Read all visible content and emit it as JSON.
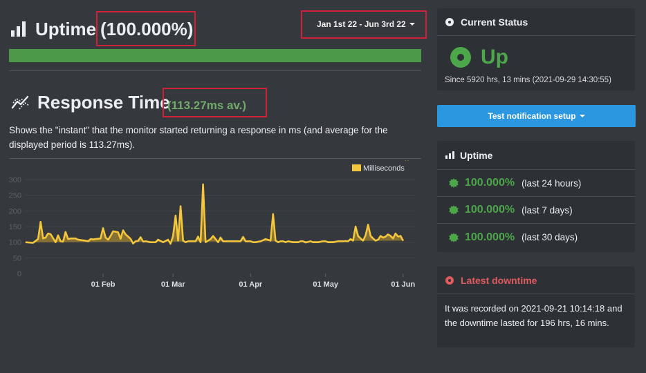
{
  "uptime": {
    "title": "Uptime",
    "percent_label": "(100.000%)",
    "bar_fill_percent": 100,
    "bar_color": "#4a9a48",
    "date_range_label": "Jan 1st 22 - Jun 3rd 22"
  },
  "response_time": {
    "title": "Response Time",
    "average_label": "(113.27ms av.)",
    "description": "Shows the \"instant\" that the monitor started returning a response in ms (and average for the displayed period is 113.27ms)."
  },
  "chart_data": {
    "type": "area",
    "title": "",
    "xlabel": "",
    "ylabel": "",
    "legend": "top-right",
    "grid": true,
    "ylim": [
      0,
      300
    ],
    "yticks": [
      0,
      50,
      100,
      150,
      200,
      250,
      300
    ],
    "x_start": "2022-01-01",
    "x_end": "2022-06-03",
    "xticks": [
      {
        "label": "01 Feb",
        "day": 31
      },
      {
        "label": "01 Mar",
        "day": 59
      },
      {
        "label": "01 Apr",
        "day": 90
      },
      {
        "label": "01 May",
        "day": 120
      },
      {
        "label": "01 Jun",
        "day": 151
      }
    ],
    "line_color": "#f4c63d",
    "fill_color": "#8b7433",
    "series": [
      {
        "name": "Milliseconds",
        "x_day": [
          0,
          3,
          5,
          6,
          7,
          8,
          9,
          10,
          12,
          13,
          14,
          15,
          16,
          17,
          18,
          20,
          21,
          22,
          24,
          25,
          26,
          27,
          28,
          30,
          31,
          32,
          33,
          34,
          35,
          37,
          38,
          39,
          40,
          41,
          42,
          43,
          44,
          45,
          46,
          47,
          48,
          50,
          52,
          53,
          55,
          57,
          58,
          59,
          60,
          61,
          62,
          63,
          64,
          65,
          66,
          67,
          68,
          69,
          70,
          71,
          72,
          74,
          75,
          76,
          77,
          78,
          79,
          80,
          81,
          82,
          83,
          84,
          85,
          86,
          87,
          88,
          89,
          90,
          91,
          92,
          94,
          96,
          98,
          99,
          100,
          101,
          102,
          103,
          104,
          105,
          107,
          109,
          110,
          111,
          112,
          113,
          114,
          115,
          117,
          119,
          120,
          121,
          123,
          125,
          127,
          128,
          129,
          130,
          131,
          132,
          133,
          134,
          135,
          136,
          137,
          138,
          139,
          140,
          141,
          142,
          143,
          144,
          145,
          146,
          147,
          148,
          149,
          150,
          151,
          152,
          153
        ],
        "values": [
          100,
          98,
          110,
          165,
          112,
          115,
          128,
          126,
          100,
          122,
          103,
          102,
          133,
          110,
          112,
          112,
          108,
          107,
          105,
          103,
          110,
          109,
          110,
          112,
          145,
          115,
          108,
          120,
          135,
          132,
          111,
          138,
          125,
          118,
          111,
          96,
          103,
          104,
          116,
          102,
          103,
          100,
          100,
          108,
          100,
          108,
          95,
          120,
          185,
          105,
          215,
          105,
          100,
          103,
          103,
          103,
          103,
          118,
          100,
          285,
          100,
          110,
          120,
          110,
          100,
          115,
          103,
          103,
          103,
          103,
          103,
          103,
          103,
          103,
          117,
          103,
          103,
          103,
          100,
          100,
          103,
          110,
          105,
          190,
          105,
          100,
          103,
          103,
          100,
          103,
          100,
          100,
          103,
          103,
          99,
          101,
          103,
          100,
          100,
          103,
          103,
          100,
          100,
          103,
          103,
          104,
          103,
          110,
          105,
          150,
          120,
          112,
          105,
          122,
          156,
          120,
          112,
          105,
          108,
          120,
          115,
          118,
          125,
          120,
          112,
          128,
          118,
          120,
          105
        ]
      }
    ]
  },
  "current_status": {
    "title": "Current Status",
    "state": "Up",
    "since": "Since 5920 hrs, 13 mins (2021-09-29 14:30:55)"
  },
  "test_button": {
    "label": "Test notification setup"
  },
  "uptime_panel": {
    "title": "Uptime",
    "items": [
      {
        "percent": "100.000%",
        "period": "(last 24 hours)"
      },
      {
        "percent": "100.000%",
        "period": "(last 7 days)"
      },
      {
        "percent": "100.000%",
        "period": "(last 30 days)"
      }
    ]
  },
  "latest_downtime": {
    "title": "Latest downtime",
    "text": "It was recorded on 2021-09-21 10:14:18 and the downtime lasted for 196 hrs, 16 mins."
  },
  "colors": {
    "up_green": "#4ca64a",
    "down_red": "#e05a5e",
    "button_blue": "#2c97e1",
    "highlight_red": "#d0213a"
  }
}
